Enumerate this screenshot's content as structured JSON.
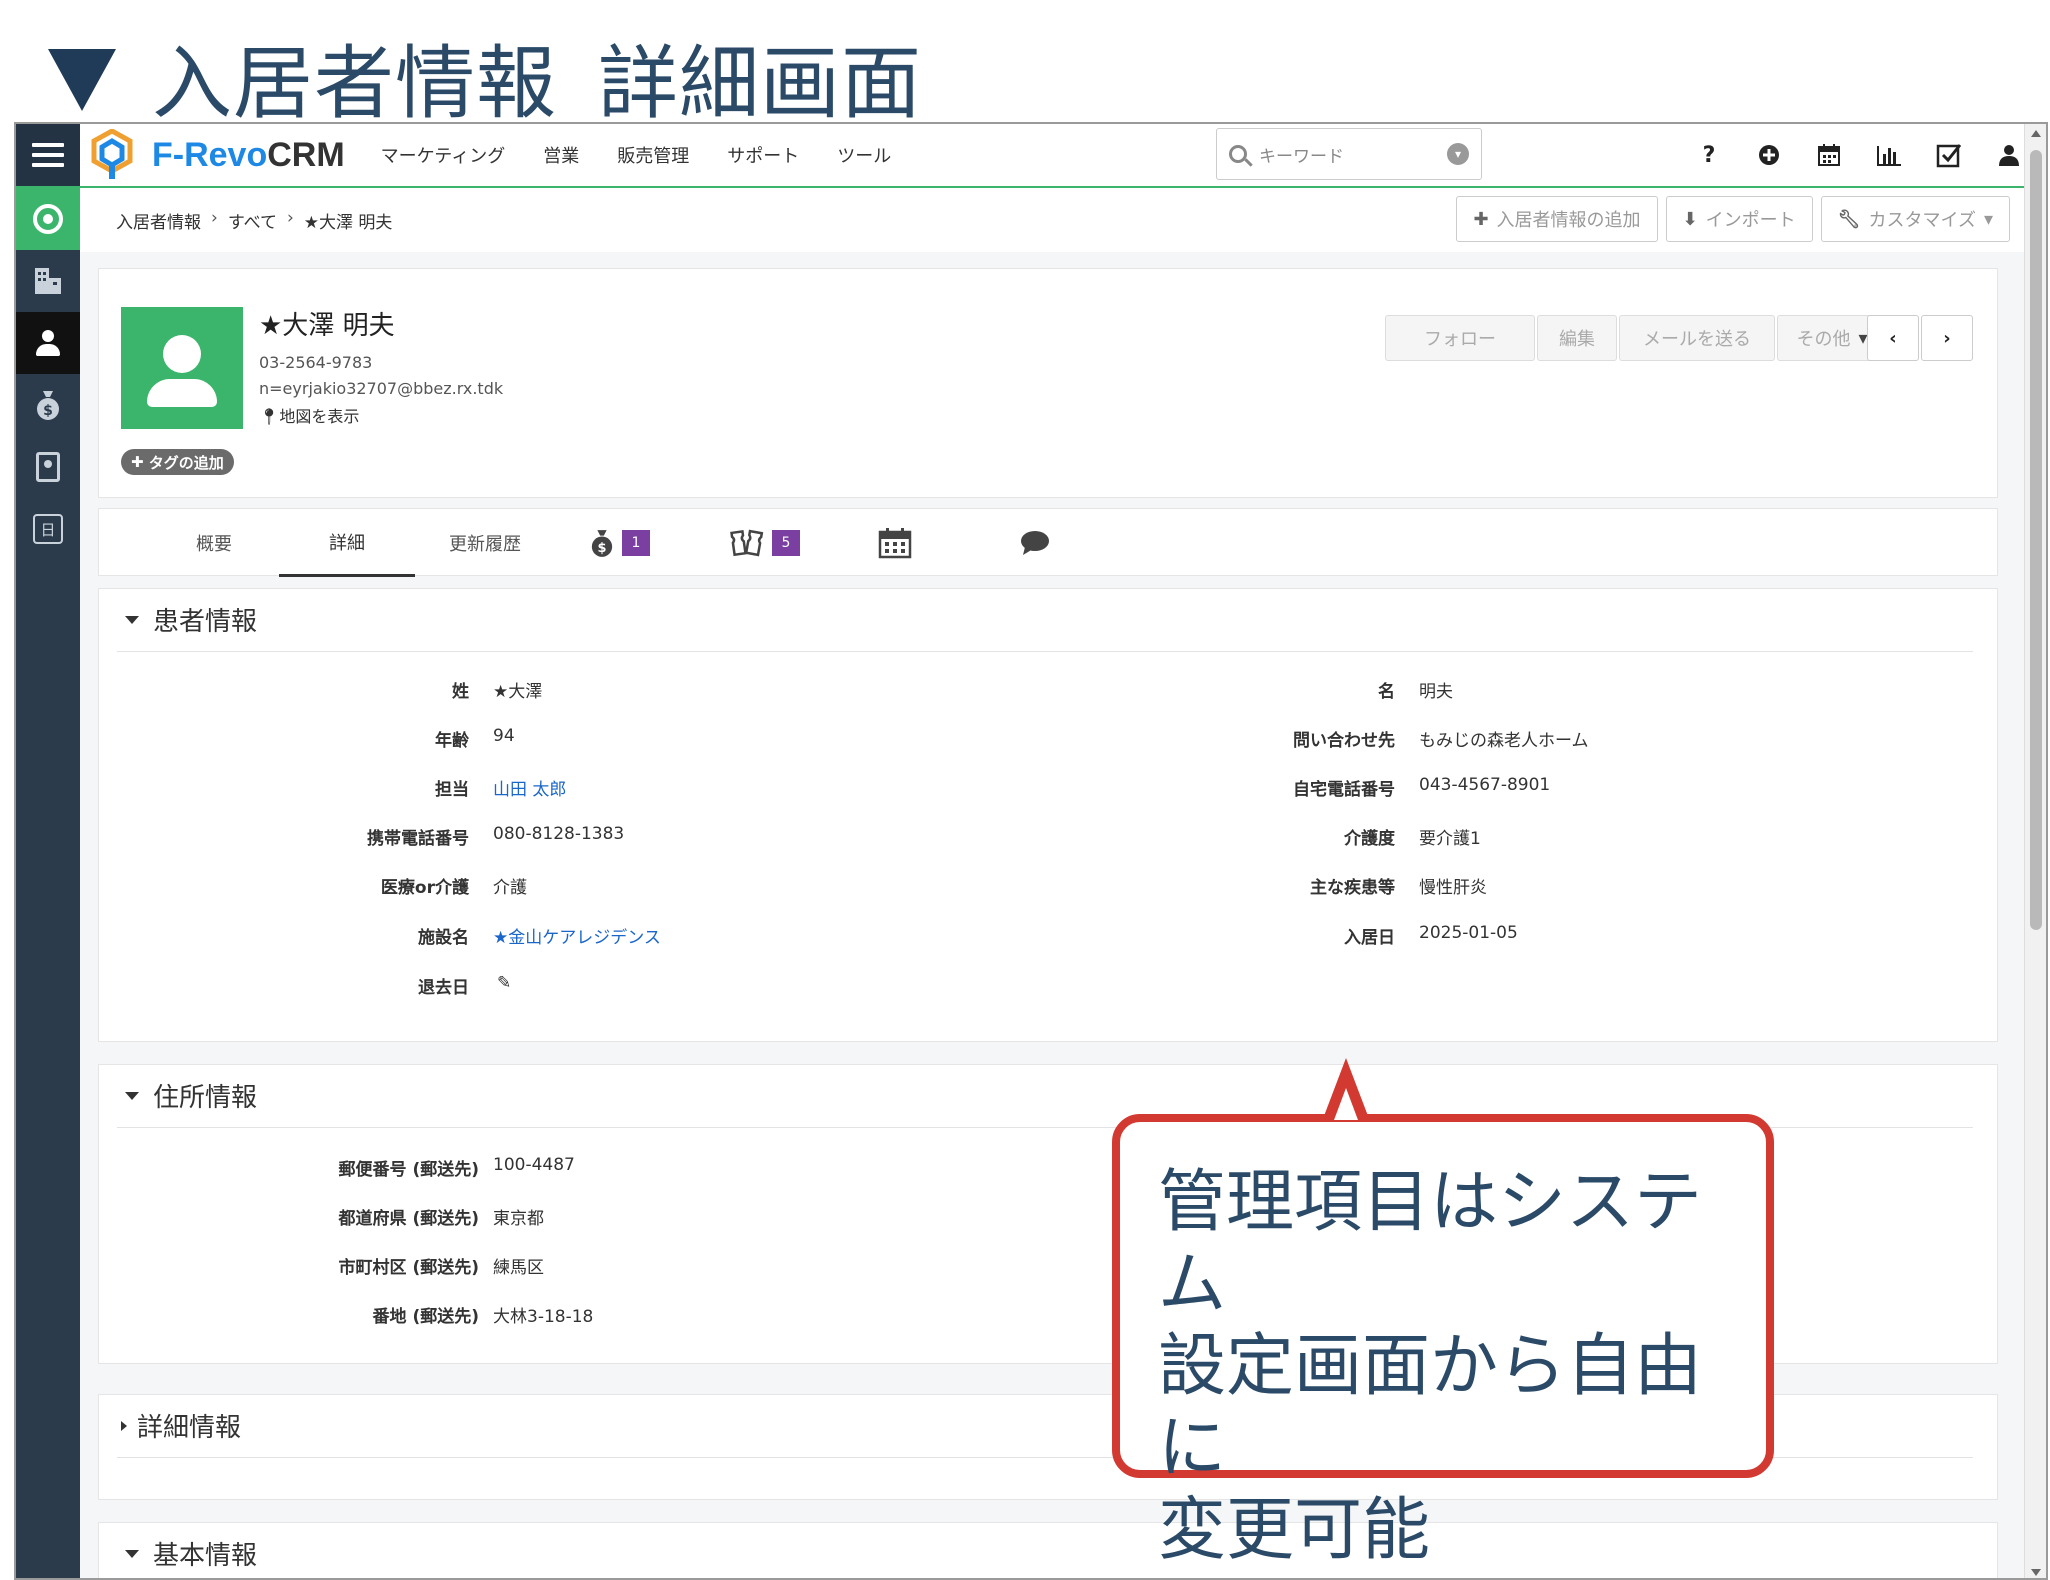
{
  "slide": {
    "title": "入居者情報_詳細画面"
  },
  "nav": {
    "brand_prefix": "F-Revo",
    "brand_suffix": "CRM",
    "menu": [
      "マーケティング",
      "営業",
      "販売管理",
      "サポート",
      "ツール"
    ],
    "search_placeholder": "キーワード",
    "right_icons": [
      "help-icon",
      "add-circle-icon",
      "calendar-icon",
      "chart-icon",
      "checkbox-icon",
      "user-icon"
    ]
  },
  "breadcrumb": {
    "module": "入居者情報",
    "filter": "すべて",
    "record": "★大澤 明夫"
  },
  "header_buttons": {
    "add": "入居者情報の追加",
    "import": "インポート",
    "customize": "カスタマイズ"
  },
  "record": {
    "name": "★大澤 明夫",
    "phone": "03-2564-9783",
    "email": "n=eyrjakio32707@bbez.rx.tdk",
    "map": "地図を表示",
    "tag_add": "タグの追加",
    "actions": {
      "follow": "フォロー",
      "edit": "編集",
      "send_mail": "メールを送る",
      "more": "その他"
    }
  },
  "tabs": {
    "summary": "概要",
    "detail": "詳細",
    "history": "更新履歴",
    "deals_count": "1",
    "tickets_count": "5"
  },
  "blocks": {
    "patient": {
      "title": "患者情報",
      "left": [
        {
          "label": "姓",
          "value": "★大澤"
        },
        {
          "label": "年齢",
          "value": "94"
        },
        {
          "label": "担当",
          "value": "山田 太郎"
        },
        {
          "label": "携帯電話番号",
          "value": "080-8128-1383"
        },
        {
          "label": "医療or介護",
          "value": "介護"
        },
        {
          "label": "施設名",
          "value": "★金山ケアレジデンス"
        },
        {
          "label": "退去日",
          "value": ""
        }
      ],
      "right": [
        {
          "label": "名",
          "value": "明夫"
        },
        {
          "label": "問い合わせ先",
          "value": "もみじの森老人ホーム"
        },
        {
          "label": "自宅電話番号",
          "value": "043-4567-8901"
        },
        {
          "label": "介護度",
          "value": "要介護1"
        },
        {
          "label": "主な疾患等",
          "value": "慢性肝炎"
        },
        {
          "label": "入居日",
          "value": "2025-01-05"
        }
      ]
    },
    "address": {
      "title": "住所情報",
      "fields": [
        {
          "label": "郵便番号 (郵送先)",
          "value": "100-4487"
        },
        {
          "label": "都道府県 (郵送先)",
          "value": "東京都"
        },
        {
          "label": "市町村区 (郵送先)",
          "value": "練馬区"
        },
        {
          "label": "番地 (郵送先)",
          "value": "大林3-18-18"
        }
      ]
    },
    "detail": {
      "title": "詳細情報"
    },
    "basic": {
      "title": "基本情報"
    }
  },
  "callout": {
    "line1": "管理項目はシステム",
    "line2": "設定画面から自由に",
    "line3": "変更可能"
  },
  "colors": {
    "accent_green": "#3bb56b",
    "sidebar": "#2b3b4c",
    "link": "#1a66c9",
    "badge": "#7a3fa0",
    "callout_border": "#d23a31"
  }
}
